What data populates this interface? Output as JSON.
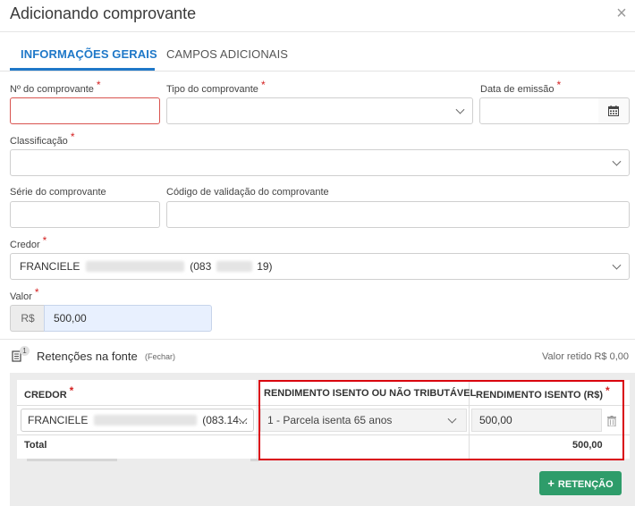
{
  "dialog": {
    "title": "Adicionando comprovante"
  },
  "tabs": [
    {
      "label": "INFORMAÇÕES GERAIS"
    },
    {
      "label": "CAMPOS ADICIONAIS"
    }
  ],
  "form": {
    "numero_label": "Nº do comprovante",
    "tipo_label": "Tipo do comprovante",
    "data_label": "Data de emissão",
    "classificacao_label": "Classificação",
    "serie_label": "Série do comprovante",
    "codigo_label": "Código de validação do comprovante",
    "credor_label": "Credor",
    "credor_value_start": "FRANCIELE",
    "credor_value_mid": "(083",
    "credor_value_end": "19)",
    "valor_label": "Valor",
    "valor_prefix": "R$",
    "valor_value": "500,00",
    "required_mark": "*"
  },
  "retencoes": {
    "badge": "1",
    "title": "Retenções na fonte",
    "toggle": "(Fechar)",
    "valor_retido": "Valor retido R$ 0,00",
    "columns": {
      "credor": "CREDOR",
      "rendimento": "RENDIMENTO ISENTO OU NÃO TRIBUTÁVEL",
      "isento": "RENDIMENTO ISENTO (R$)"
    },
    "row": {
      "credor_start": "FRANCIELE",
      "credor_end": "(083.14...",
      "rendimento": "1 - Parcela isenta 65 anos",
      "valor": "500,00"
    },
    "total_label": "Total",
    "total_value": "500,00",
    "add_button": "RETENÇÃO"
  },
  "colors": {
    "accent": "#1f78c8",
    "success": "#2e9c6a",
    "highlight": "#d9000d",
    "error": "#d9534f"
  }
}
